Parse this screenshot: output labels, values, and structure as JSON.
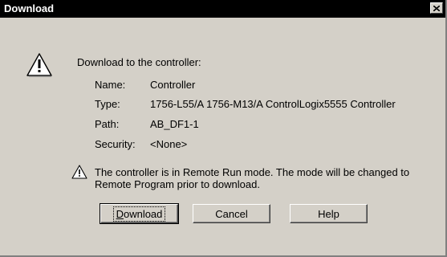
{
  "window": {
    "title": "Download"
  },
  "dialog": {
    "heading": "Download to the controller:",
    "fields": [
      {
        "label": "Name:",
        "value": "Controller"
      },
      {
        "label": "Type:",
        "value": "1756-L55/A 1756-M13/A ControlLogix5555 Controller"
      },
      {
        "label": "Path:",
        "value": "AB_DF1-1"
      },
      {
        "label": "Security:",
        "value": "<None>"
      }
    ],
    "message_line1": "The controller is in Remote Run mode. The mode will be changed to",
    "message_line2": "Remote Program prior to download."
  },
  "buttons": {
    "download": "Download",
    "cancel": "Cancel",
    "help": "Help"
  },
  "icons": {
    "big": "warning-icon",
    "small": "warning-icon",
    "close": "close-icon"
  }
}
